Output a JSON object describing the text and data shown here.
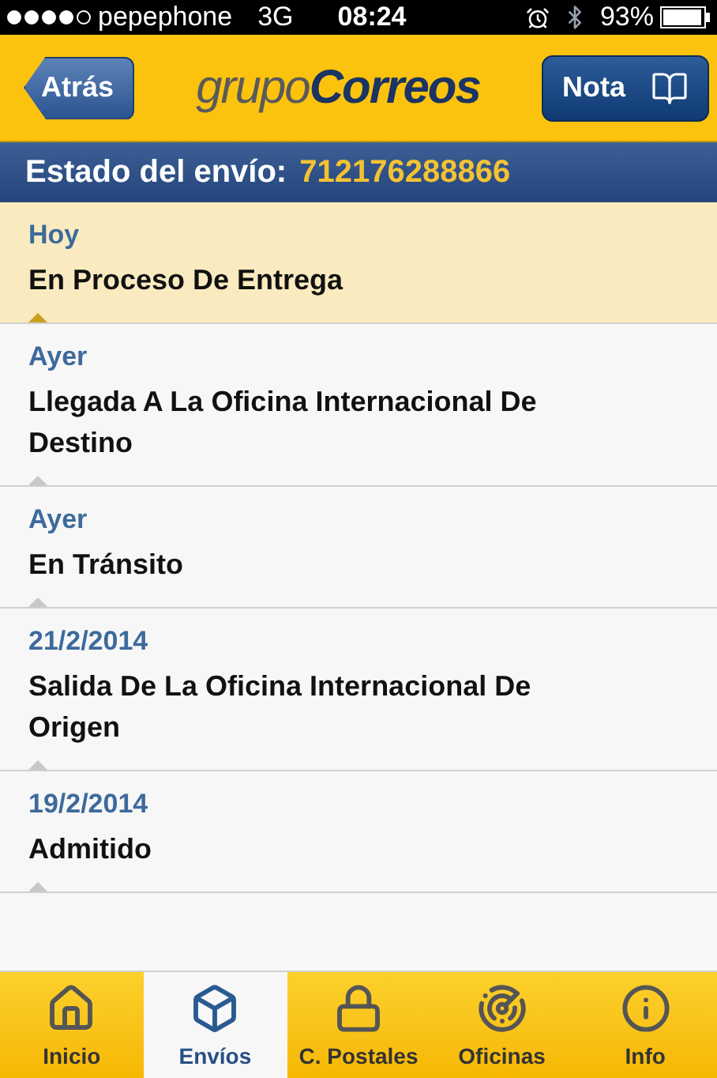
{
  "status_bar": {
    "carrier": "pepephone",
    "network": "3G",
    "time": "08:24",
    "battery": "93%"
  },
  "nav": {
    "back": "Atrás",
    "logo": "grupo**Correos**",
    "note": "Nota"
  },
  "header": {
    "label": "Estado del envío:",
    "tracking": "712176288866"
  },
  "events": [
    {
      "date": "Hoy",
      "status": "En Proceso De Entrega",
      "selected": true
    },
    {
      "date": "Ayer",
      "status": "Llegada A La Oficina Internacional De Destino",
      "selected": false
    },
    {
      "date": "Ayer",
      "status": "En Tránsito",
      "selected": false
    },
    {
      "date": "21/2/2014",
      "status": "Salida De La Oficina Internacional De Origen",
      "selected": false
    },
    {
      "date": "19/2/2014",
      "status": "Admitido",
      "selected": false
    }
  ],
  "tabs": [
    {
      "kind": "home",
      "label": "Inicio",
      "selected": false
    },
    {
      "kind": "box",
      "label": "Envíos",
      "selected": true
    },
    {
      "kind": "lock",
      "label": "C. Postales",
      "selected": false
    },
    {
      "kind": "radar",
      "label": "Oficinas",
      "selected": false
    },
    {
      "kind": "info",
      "label": "Info",
      "selected": false
    }
  ]
}
